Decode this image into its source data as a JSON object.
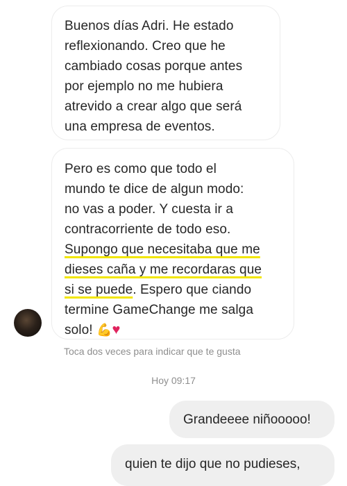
{
  "messages": [
    {
      "lines": [
        "Buenos días Adri. He estado",
        "reflexionando. Creo que he",
        "cambiado cosas porque antes",
        "por ejemplo no me hubiera",
        "atrevido a crear algo que será",
        "una empresa de eventos."
      ]
    },
    {
      "line1": "Pero es como que todo el",
      "line2": "mundo te dice de algun modo:",
      "line3": "no vas a poder. Y cuesta ir a",
      "line4": "contracorriente de todo eso.",
      "line5": "Supongo que necesitaba que me",
      "line6": "dieses caña y me recordaras que",
      "line7_hl": "si se puede",
      "line7_rest": ". Espero que ciando",
      "line8": "termine GameChange me salga",
      "line9": "solo!",
      "emoji_flex": "💪",
      "emoji_heart": "♥"
    }
  ],
  "hint": "Toca dos veces para indicar que te gusta",
  "timestamp": "Hoy 09:17",
  "sent": [
    "Grandeeee niñooooo!",
    "quien te dijo que no pudieses,"
  ],
  "colors": {
    "highlight": "#f2e600",
    "bubble_out": "#efefef",
    "bubble_in_border": "#ececec",
    "muted": "#8e8e8e"
  },
  "icons": {
    "avatar": "avatar-image"
  }
}
